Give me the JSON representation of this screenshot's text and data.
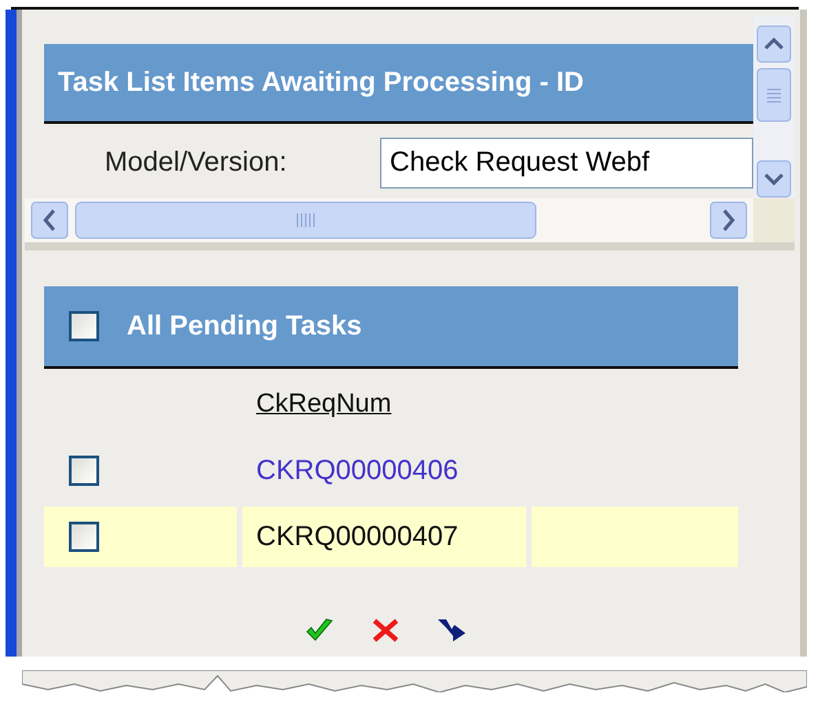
{
  "task_panel": {
    "title": "Task List Items Awaiting Processing - ID",
    "model_label": "Model/Version:",
    "model_value": "Check Request Webf"
  },
  "pending": {
    "title": "All Pending Tasks",
    "checked": false,
    "columns": [
      "CkReqNum"
    ],
    "rows": [
      {
        "number": "CKRQ00000406",
        "checked": false,
        "highlighted": false
      },
      {
        "number": "CKRQ00000407",
        "checked": false,
        "highlighted": true
      }
    ],
    "actions": [
      {
        "kind": "approve"
      },
      {
        "kind": "reject"
      },
      {
        "kind": "forward"
      }
    ]
  }
}
